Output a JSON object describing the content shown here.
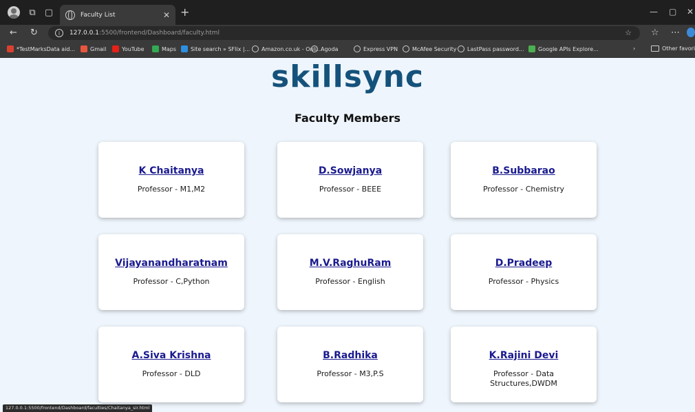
{
  "browser": {
    "tab_title": "Faculty List",
    "url_host": "127.0.0.1",
    "url_path": ":5500/frontend/Dashboard/faculty.html",
    "bookmarks": [
      {
        "label": "*TestMarksData aid...",
        "color": "#d9412f",
        "type": "icon"
      },
      {
        "label": "Gmail",
        "color": "#e8553f",
        "type": "icon"
      },
      {
        "label": "YouTube",
        "color": "#e62117",
        "type": "icon"
      },
      {
        "label": "Maps",
        "color": "#34a853",
        "type": "icon"
      },
      {
        "label": "Site search » SFlix |...",
        "color": "#2d8fe0",
        "type": "icon"
      },
      {
        "label": "Amazon.co.uk - Onli...",
        "color": "",
        "type": "globe"
      },
      {
        "label": "Agoda",
        "color": "",
        "type": "globe"
      },
      {
        "label": "Express VPN",
        "color": "",
        "type": "globe"
      },
      {
        "label": "McAfee Security",
        "color": "",
        "type": "globe"
      },
      {
        "label": "LastPass password...",
        "color": "",
        "type": "globe"
      },
      {
        "label": "Google APIs Explore...",
        "color": "#4caf50",
        "type": "icon"
      }
    ],
    "other_favorites": "Other favorite",
    "status_url": "127.0.0.1:5500/frontend/Dashboard/faculties/Chaitanya_sir.html"
  },
  "page": {
    "logo": "skillsync",
    "title": "Faculty Members",
    "brand_color": "#15527b"
  },
  "faculty": [
    {
      "name": "K Chaitanya",
      "role": "Professor - M1,M2"
    },
    {
      "name": "D.Sowjanya",
      "role": "Professor - BEEE"
    },
    {
      "name": "B.Subbarao",
      "role": "Professor - Chemistry"
    },
    {
      "name": "Vijayanandharatnam",
      "role": "Professor - C,Python"
    },
    {
      "name": "M.V.RaghuRam",
      "role": "Professor - English"
    },
    {
      "name": "D.Pradeep",
      "role": "Professor - Physics"
    },
    {
      "name": "A.Siva Krishna",
      "role": "Professor - DLD"
    },
    {
      "name": "B.Radhika",
      "role": "Professor - M3,P.S"
    },
    {
      "name": "K.Rajini Devi",
      "role": "Professor - Data Structures,DWDM"
    }
  ]
}
